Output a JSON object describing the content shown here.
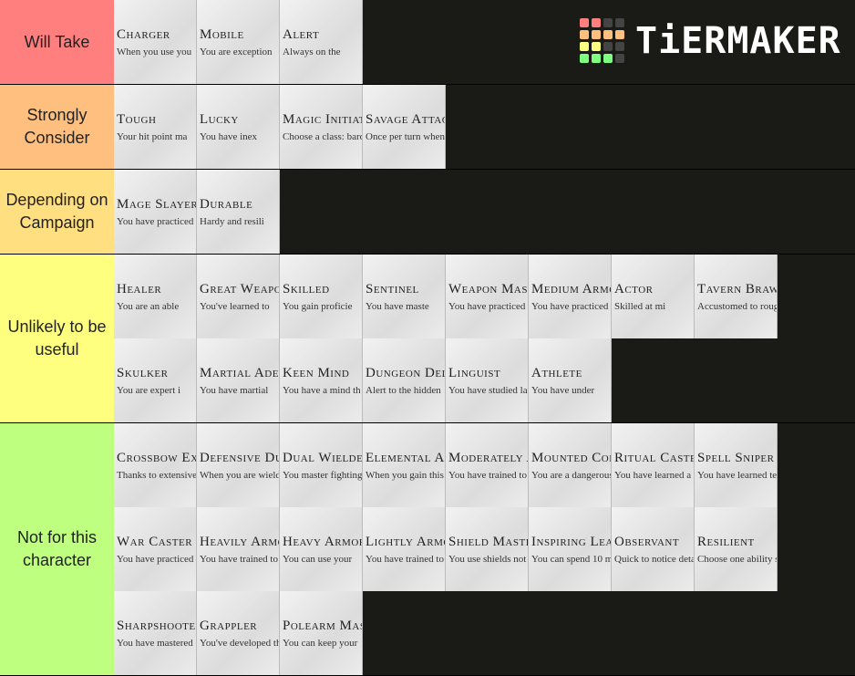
{
  "logo": {
    "text": "TiERMAKER",
    "grid": [
      "#ff7f7f",
      "#ff7f7f",
      "#444444",
      "#444444",
      "#ffbf7f",
      "#ffbf7f",
      "#ffbf7f",
      "#ffbf7f",
      "#ffff7f",
      "#ffff7f",
      "#444444",
      "#444444",
      "#7fff7f",
      "#7fff7f",
      "#7fff7f",
      "#444444"
    ]
  },
  "tiers": [
    {
      "label": "Will Take",
      "color": "#ff7f7f",
      "lines": 1,
      "items": [
        {
          "title": "Charger",
          "text": "When you use you"
        },
        {
          "title": "Mobile",
          "text": "You are exception"
        },
        {
          "title": "Alert",
          "text": "Always on the"
        }
      ]
    },
    {
      "label": "Strongly Consider",
      "color": "#ffbf7f",
      "lines": 1,
      "items": [
        {
          "title": "Tough",
          "text": "Your hit point ma"
        },
        {
          "title": "Lucky",
          "text": "You have inex"
        },
        {
          "title": "Magic Initiate",
          "text": "Choose a class: bard"
        },
        {
          "title": "Savage Attacker",
          "text": "Once per turn when"
        }
      ]
    },
    {
      "label": "Depending on Campaign",
      "color": "#ffdf7f",
      "lines": 1,
      "items": [
        {
          "title": "Mage Slayer",
          "text": "You have practiced"
        },
        {
          "title": "Durable",
          "text": "Hardy and resili"
        }
      ]
    },
    {
      "label": "Unlikely to be useful",
      "color": "#ffff7f",
      "lines": 2,
      "items": [
        {
          "title": "Healer",
          "text": "You are an able"
        },
        {
          "title": "Great Weapon Master",
          "text": "You've learned to"
        },
        {
          "title": "Skilled",
          "text": "You gain proficie"
        },
        {
          "title": "Sentinel",
          "text": "You have maste"
        },
        {
          "title": "Weapon Master",
          "text": "You have practiced"
        },
        {
          "title": "Medium Armor Master",
          "text": "You have practiced"
        },
        {
          "title": "Actor",
          "text": "Skilled at mi"
        },
        {
          "title": "Tavern Brawler",
          "text": "Accustomed to rough"
        },
        {
          "title": "Skulker",
          "text": "You are expert i"
        },
        {
          "title": "Martial Adept",
          "text": "You have martial"
        },
        {
          "title": "Keen Mind",
          "text": "You have a mind th"
        },
        {
          "title": "Dungeon Delver",
          "text": "Alert to the hidden"
        },
        {
          "title": "Linguist",
          "text": "You have studied la"
        },
        {
          "title": "Athlete",
          "text": "You have under"
        }
      ]
    },
    {
      "label": "Not for this character",
      "color": "#bfff7f",
      "lines": 3,
      "items": [
        {
          "title": "Crossbow Expert",
          "text": "Thanks to extensive"
        },
        {
          "title": "Defensive Duelist",
          "text": "When you are wielding"
        },
        {
          "title": "Dual Wielder",
          "text": "You master fighting"
        },
        {
          "title": "Elemental Adept",
          "text": "When you gain this feat"
        },
        {
          "title": "Moderately Armored",
          "text": "You have trained to"
        },
        {
          "title": "Mounted Combatant",
          "text": "You are a dangerous"
        },
        {
          "title": "Ritual Caster",
          "text": "You have learned a"
        },
        {
          "title": "Spell Sniper",
          "text": "You have learned tec"
        },
        {
          "title": "War Caster",
          "text": "You have practiced c"
        },
        {
          "title": "Heavily Armored",
          "text": "You have trained to"
        },
        {
          "title": "Heavy Armor Master",
          "text": "You can use your"
        },
        {
          "title": "Lightly Armored",
          "text": "You have trained to"
        },
        {
          "title": "Shield Master",
          "text": "You use shields not"
        },
        {
          "title": "Inspiring Leader",
          "text": "You can spend 10 min"
        },
        {
          "title": "Observant",
          "text": "Quick to notice detai"
        },
        {
          "title": "Resilient",
          "text": "Choose one ability sc"
        },
        {
          "title": "Sharpshooter",
          "text": "You have mastered"
        },
        {
          "title": "Grappler",
          "text": "You've developed th"
        },
        {
          "title": "Polearm Master",
          "text": "You can keep your"
        }
      ]
    }
  ]
}
